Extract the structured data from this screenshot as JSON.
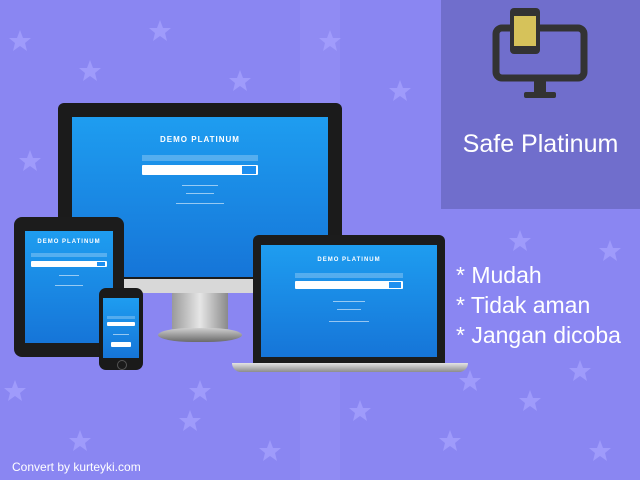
{
  "panel": {
    "title": "Safe Platinum",
    "icon": "tablet-monitor-icon"
  },
  "features": [
    "* Mudah",
    "* Tidak aman",
    "* Jangan dicoba"
  ],
  "credit": "Convert by kurteyki.com",
  "mockups": {
    "demo_title": "DEMO PLATINUM",
    "devices": [
      "monitor",
      "tablet",
      "laptop",
      "phone"
    ]
  },
  "colors": {
    "background": "#8a86f2",
    "panel": "#6e6cc9",
    "screen_top": "#1e9df0",
    "screen_bottom": "#1675d8",
    "text": "#ffffff"
  }
}
